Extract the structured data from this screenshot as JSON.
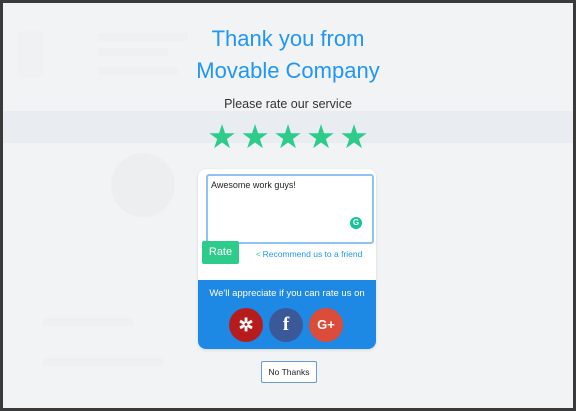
{
  "modal": {
    "title_line1": "Thank you from",
    "title_line2": "Movable Company",
    "prompt": "Please rate our service",
    "stars": [
      "★",
      "★",
      "★",
      "★",
      "★"
    ],
    "rating": 5,
    "review_text": "Awesome work guys!",
    "grammarly_icon": "G",
    "rate_button": "Rate",
    "recommend_icon": "share-icon",
    "recommend_link": "Recommend us to a friend",
    "appreciate_text": "We'll appreciate if you can rate us on",
    "social": {
      "yelp_glyph": "✲",
      "facebook_glyph": "f",
      "gplus_glyph": "G+"
    },
    "no_thanks": "No Thanks"
  },
  "colors": {
    "accent_blue": "#2196f3",
    "star_green": "#2ecc8a",
    "panel_blue": "#1e88e5",
    "yelp_red": "#b71c1c",
    "facebook_blue": "#3b5998",
    "gplus_red": "#dd4b39"
  }
}
